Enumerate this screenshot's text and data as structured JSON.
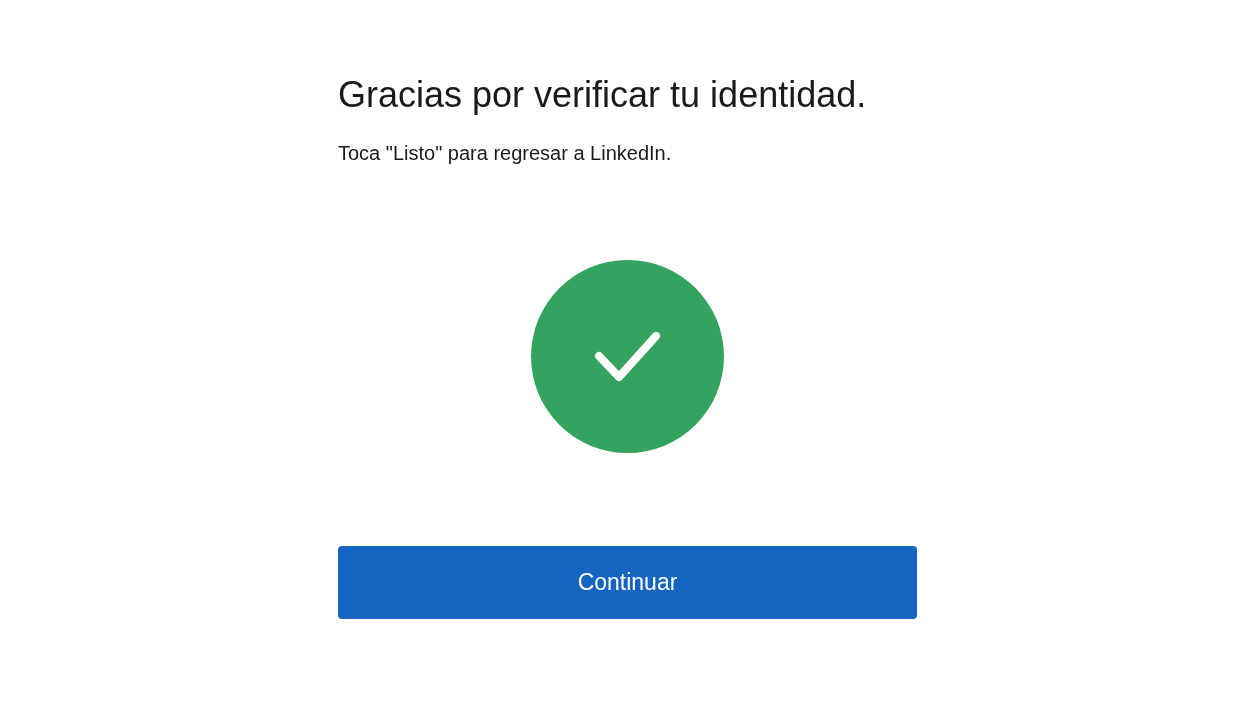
{
  "title": "Gracias por verificar tu identidad.",
  "message": "Toca \"Listo\" para regresar a LinkedIn.",
  "status": {
    "kind": "success"
  },
  "button": {
    "label": "Continuar"
  }
}
